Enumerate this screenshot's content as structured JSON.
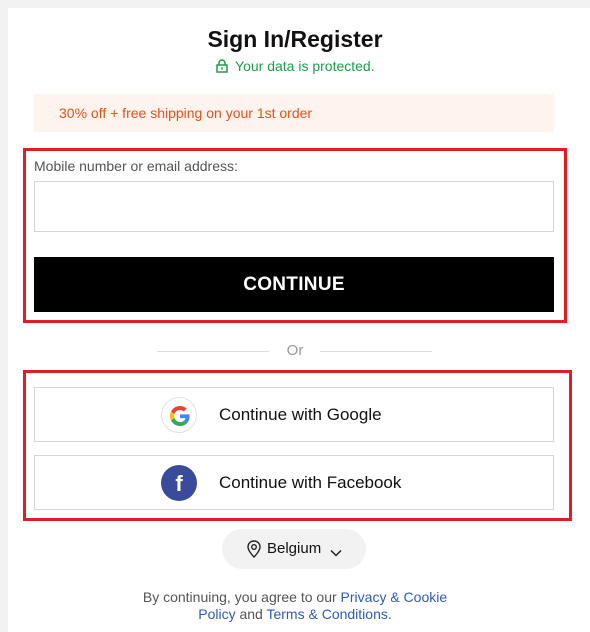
{
  "header": {
    "title": "Sign In/Register",
    "protected_text": "Your data is protected."
  },
  "promo": {
    "text": "30% off + free shipping on your 1st order"
  },
  "login_form": {
    "field_label": "Mobile number or email address:",
    "field_value": "",
    "field_placeholder": "",
    "continue_label": "CONTINUE"
  },
  "divider": {
    "or_text": "Or"
  },
  "social": {
    "google_label": "Continue with Google",
    "facebook_label": "Continue with Facebook"
  },
  "country": {
    "selected": "Belgium"
  },
  "legal": {
    "prefix": "By continuing, you agree to our ",
    "privacy_link_part1": "Privacy & Cookie",
    "privacy_link_part2": "Policy",
    "and": " and ",
    "terms_link": "Terms & Conditions",
    "suffix": "."
  },
  "colors": {
    "protected_green": "#1a9e46",
    "promo_orange": "#e0531c",
    "promo_bg": "#fff3ed",
    "highlight_red": "#e01e22",
    "facebook_blue": "#3a4b9c",
    "link_blue": "#2f5bb7"
  },
  "icons": [
    "lock-icon",
    "google-icon",
    "facebook-icon",
    "location-pin-icon",
    "chevron-down-icon"
  ]
}
